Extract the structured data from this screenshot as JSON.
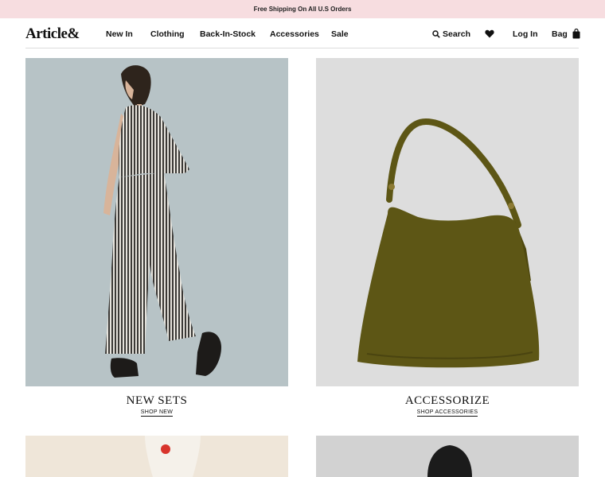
{
  "announcement": "Free Shipping On All U.S Orders",
  "brand": "Article&",
  "nav": [
    "New In",
    "Clothing",
    "Back-In-Stock",
    "Accessories",
    "Sale"
  ],
  "utility": {
    "search": "Search",
    "login": "Log In",
    "bag": "Bag"
  },
  "icons": {
    "search": "search-icon",
    "wishlist": "heart-icon",
    "bag": "bag-icon",
    "cardigan_button": "button-detail"
  },
  "colors": {
    "announcement_bg": "#f7dde0",
    "photo_bg_left": "#b9c4c7",
    "photo_bg_right": "#dcdcdc",
    "bag_color": "#5d5615"
  },
  "tiles": [
    {
      "title": "NEW SETS",
      "link": "SHOP NEW"
    },
    {
      "title": "ACCESSORIZE",
      "link": "SHOP ACCESSORIES"
    }
  ]
}
